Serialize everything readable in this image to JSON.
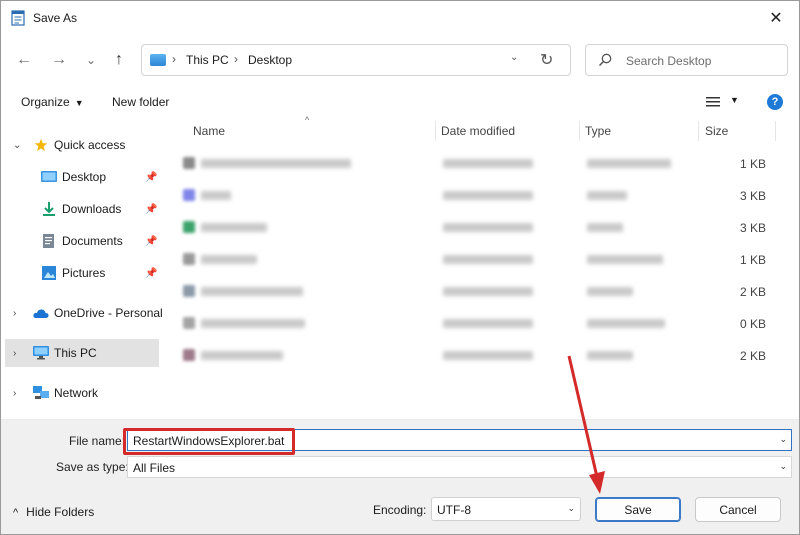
{
  "window": {
    "title": "Save As",
    "close_glyph": "✕"
  },
  "nav": {
    "back_glyph": "←",
    "forward_glyph": "→",
    "recent_glyph": "⌄",
    "up_glyph": "↑",
    "address": {
      "parts": [
        "This PC",
        "Desktop"
      ],
      "separator": "›",
      "dropdown_glyph": "⌄",
      "refresh_glyph": "↻"
    },
    "search_placeholder": "Search Desktop"
  },
  "toolbar": {
    "organize_label": "Organize",
    "new_folder_label": "New folder",
    "help_label": "?"
  },
  "sidebar": {
    "items": [
      {
        "label": "Quick access",
        "icon": "star-icon"
      },
      {
        "label": "Desktop",
        "icon": "desktop-icon",
        "pinned": true
      },
      {
        "label": "Downloads",
        "icon": "download-icon",
        "pinned": true
      },
      {
        "label": "Documents",
        "icon": "documents-icon",
        "pinned": true
      },
      {
        "label": "Pictures",
        "icon": "pictures-icon",
        "pinned": true
      },
      {
        "label": "OneDrive - Personal",
        "icon": "onedrive-icon"
      },
      {
        "label": "This PC",
        "icon": "this-pc-icon",
        "selected": true
      },
      {
        "label": "Network",
        "icon": "network-icon"
      }
    ]
  },
  "filelist": {
    "columns": [
      "Name",
      "Date modified",
      "Type",
      "Size"
    ],
    "sizes": [
      "1 KB",
      "3 KB",
      "3 KB",
      "1 KB",
      "2 KB",
      "0 KB",
      "2 KB"
    ]
  },
  "form": {
    "filename_label": "File name:",
    "filename_value": "RestartWindowsExplorer.bat",
    "type_label": "Save as type:",
    "type_value": "All Files"
  },
  "footer": {
    "hide_folders_label": "Hide Folders",
    "encoding_label": "Encoding:",
    "encoding_value": "UTF-8",
    "save_label": "Save",
    "cancel_label": "Cancel"
  },
  "colors": {
    "accent": "#1f7ad7",
    "highlight": "#d42a2a",
    "selected_bg": "#e2e2e2"
  }
}
